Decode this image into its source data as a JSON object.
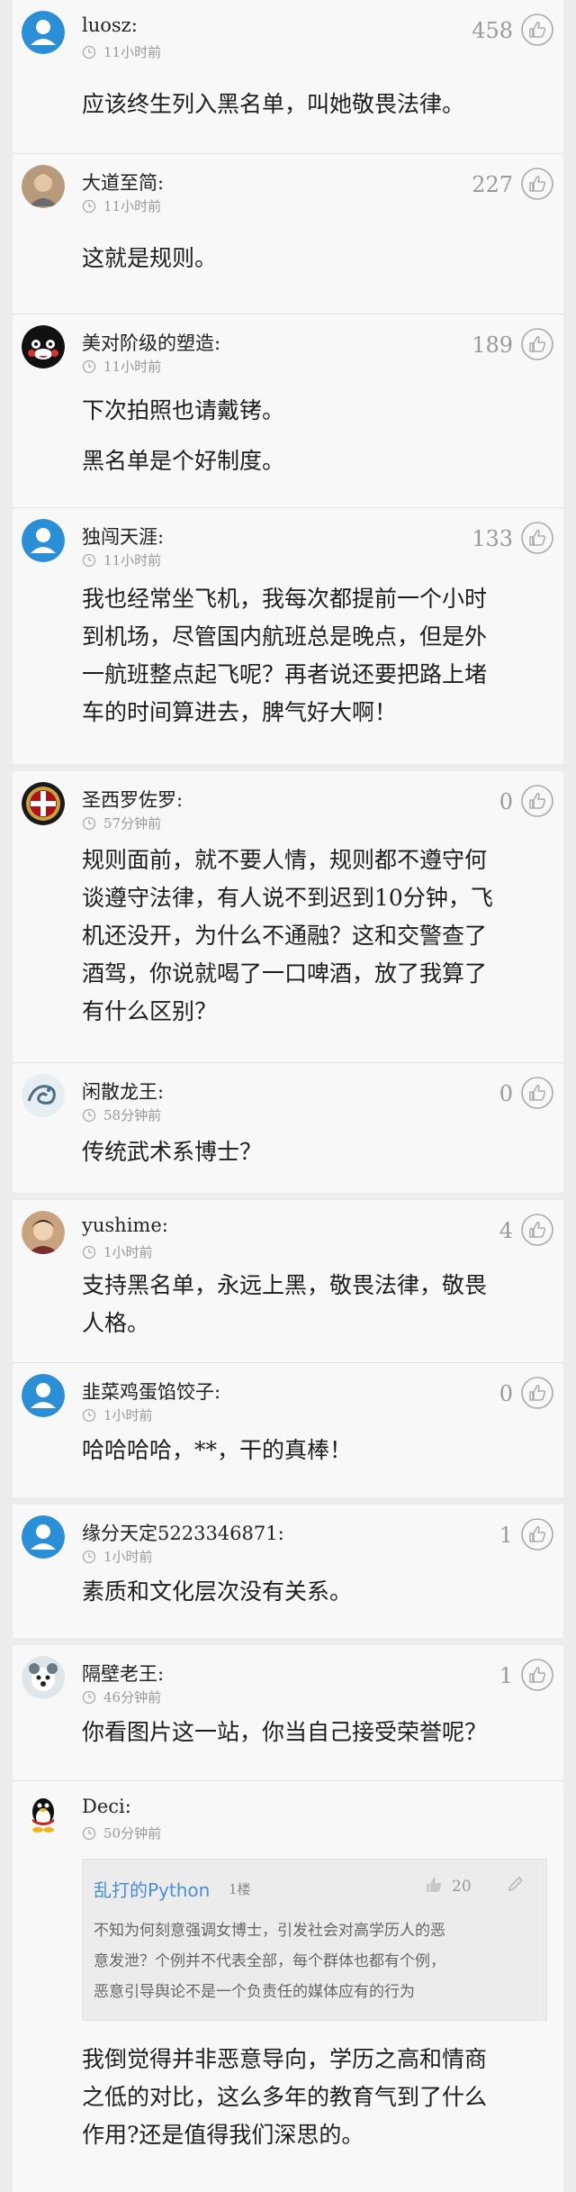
{
  "colors": {
    "default_avatar": "#2b8fd8",
    "accent_blue": "#4a8fd6",
    "meta_gray": "#999999"
  },
  "comments": [
    {
      "user": "luosz:",
      "time": "11小时前",
      "likes": "458",
      "avatar": "default-user-avatar",
      "lines": [
        "应该终生列入黑名单，叫她敬畏法律。"
      ]
    },
    {
      "user": "大道至简:",
      "time": "11小时前",
      "likes": "227",
      "avatar": "photo-avatar",
      "lines": [
        "这就是规则。"
      ]
    },
    {
      "user": "美对阶级的塑造:",
      "time": "11小时前",
      "likes": "189",
      "avatar": "bear-avatar",
      "lines": [
        "下次拍照也请戴铐。"
      ],
      "lines2": [
        "黑名单是个好制度。"
      ]
    },
    {
      "user": "独闯天涯:",
      "time": "11小时前",
      "likes": "133",
      "avatar": "default-user-avatar",
      "lines": [
        "我也经常坐飞机，我每次都提前一个小时",
        "到机场，尽管国内航班总是晚点，但是外",
        "一航班整点起飞呢？再者说还要把路上堵",
        "车的时间算进去，脾气好大啊！"
      ]
    },
    {
      "user": "圣西罗佐罗:",
      "time": "57分钟前",
      "likes": "0",
      "avatar": "club-badge-avatar",
      "lines": [
        "规则面前，就不要人情，规则都不遵守何",
        "谈遵守法律，有人说不到迟到10分钟，飞",
        "机还没开，为什么不通融？这和交警查了",
        "酒驾，你说就喝了一口啤酒，放了我算了",
        "有什么区别？"
      ]
    },
    {
      "user": "闲散龙王:",
      "time": "58分钟前",
      "likes": "0",
      "avatar": "dragon-avatar",
      "lines": [
        "传统武术系博士？"
      ]
    },
    {
      "user": "yushime:",
      "time": "1小时前",
      "likes": "4",
      "avatar": "photo-avatar",
      "lines": [
        "支持黑名单，永远上黑，敬畏法律，敬畏",
        "人格。"
      ]
    },
    {
      "user": "韭菜鸡蛋馅饺子:",
      "time": "1小时前",
      "likes": "0",
      "avatar": "default-user-avatar",
      "lines": [
        "哈哈哈哈，**，干的真棒！"
      ]
    },
    {
      "user": "缘分天定5223346871:",
      "time": "1小时前",
      "likes": "1",
      "avatar": "default-user-avatar",
      "lines": [
        "素质和文化层次没有关系。"
      ]
    },
    {
      "user": "隔壁老王:",
      "time": "46分钟前",
      "likes": "1",
      "avatar": "pet-avatar",
      "lines": [
        "你看图片这一站，你当自己接受荣誉呢？"
      ]
    },
    {
      "user": "Deci:",
      "time": "50分钟前",
      "likes": "",
      "avatar": "penguin-avatar",
      "quote": {
        "name": "乱打的Python",
        "floor": "1楼",
        "likes": "20",
        "lines": [
          "不知为何刻意强调女博士，引发社会对高学历人的恶",
          "意发泄？个例并不代表全部，每个群体也都有个例，",
          "恶意引导舆论不是一个负责任的媒体应有的行为"
        ]
      },
      "lines": [
        "我倒觉得并非恶意导向，学历之高和情商",
        "之低的对比，这么多年的教育气到了什么",
        "作用?还是值得我们深思的。"
      ]
    }
  ]
}
